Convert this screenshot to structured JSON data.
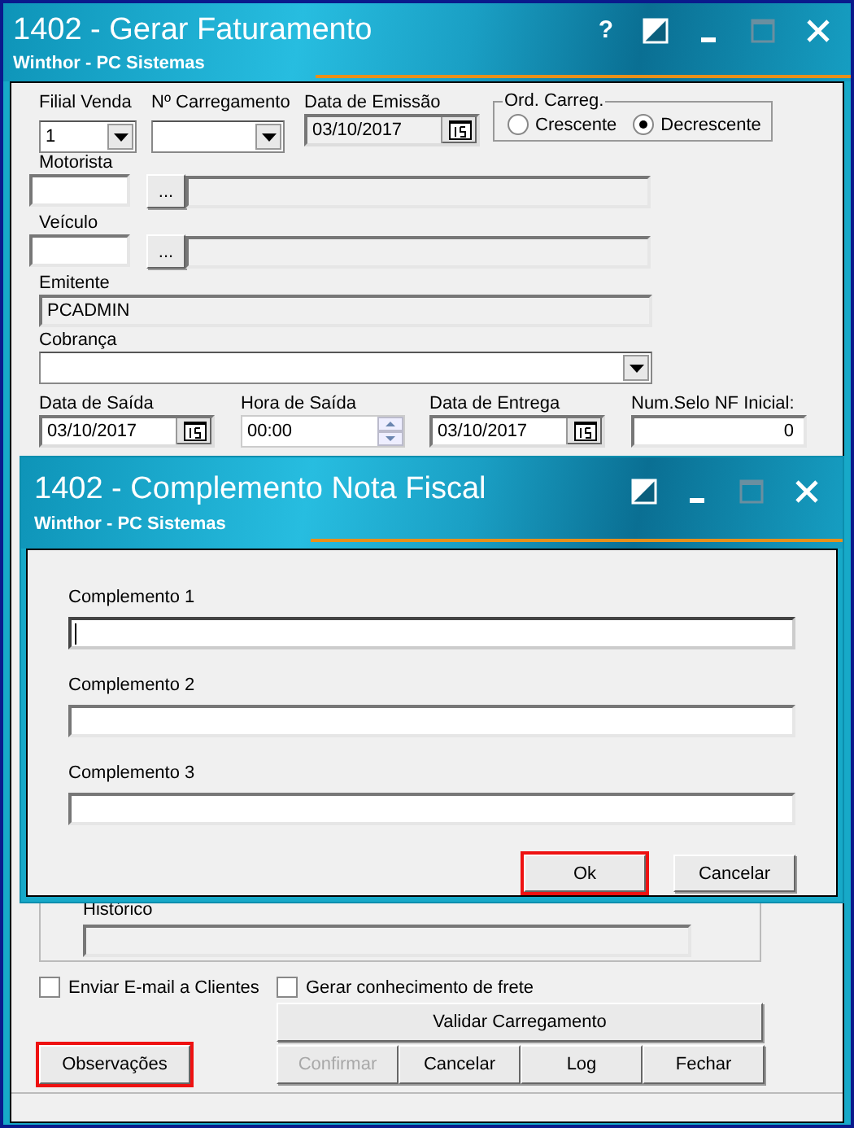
{
  "main_window": {
    "title": "1402 - Gerar Faturamento",
    "subtitle": "Winthor - PC Sistemas",
    "title_buttons": [
      {
        "kind": "help",
        "label": "?",
        "disabled": false
      },
      {
        "kind": "theme",
        "disabled": false
      },
      {
        "kind": "minimize",
        "disabled": false
      },
      {
        "kind": "maximize",
        "disabled": true
      },
      {
        "kind": "close",
        "disabled": false
      }
    ],
    "filial_venda": {
      "label": "Filial Venda",
      "value": "1"
    },
    "carregamento": {
      "label": "Nº Carregamento"
    },
    "data_emissao": {
      "label": "Data de Emissão",
      "value": "03/10/2017"
    },
    "ord_carreg": {
      "label": "Ord. Carreg.",
      "options": [
        {
          "label": "Crescente",
          "selected": false
        },
        {
          "label": "Decrescente",
          "selected": true
        }
      ]
    },
    "motorista": {
      "label": "Motorista",
      "button": "..."
    },
    "veiculo": {
      "label": "Veículo",
      "button": "..."
    },
    "emitente": {
      "label": "Emitente",
      "value": "PCADMIN"
    },
    "cobranca": {
      "label": "Cobrança"
    },
    "data_saida": {
      "label": "Data de Saída",
      "value": "03/10/2017"
    },
    "hora_saida": {
      "label": "Hora de Saída",
      "value": "00:00"
    },
    "data_entrega": {
      "label": "Data de Entrega",
      "value": "03/10/2017"
    },
    "num_selo": {
      "label": "Num.Selo NF Inicial:",
      "value": "0"
    },
    "historico": {
      "label": "Histórico"
    },
    "checkboxes": [
      {
        "label": "Enviar E-mail a Clientes",
        "checked": false
      },
      {
        "label": "Gerar conhecimento de frete",
        "checked": false
      }
    ],
    "validar_button": {
      "label": "Validar Carregamento"
    },
    "observacoes_button": {
      "label": "Observações",
      "highlighted": true
    },
    "action_buttons": [
      {
        "label": "Confirmar",
        "disabled": true
      },
      {
        "label": "Cancelar",
        "disabled": false
      },
      {
        "label": "Log",
        "disabled": false
      },
      {
        "label": "Fechar",
        "disabled": false
      }
    ]
  },
  "dialog": {
    "title": "1402 - Complemento Nota Fiscal",
    "subtitle": "Winthor - PC Sistemas",
    "title_buttons": [
      {
        "kind": "theme",
        "disabled": false
      },
      {
        "kind": "minimize",
        "disabled": false
      },
      {
        "kind": "maximize",
        "disabled": true
      },
      {
        "kind": "close",
        "disabled": false
      }
    ],
    "fields": [
      {
        "label": "Complemento 1",
        "focused": true
      },
      {
        "label": "Complemento 2",
        "focused": false
      },
      {
        "label": "Complemento 3",
        "focused": false
      }
    ],
    "buttons": [
      {
        "label": "Ok",
        "highlighted": true
      },
      {
        "label": "Cancelar",
        "highlighted": false
      }
    ]
  }
}
